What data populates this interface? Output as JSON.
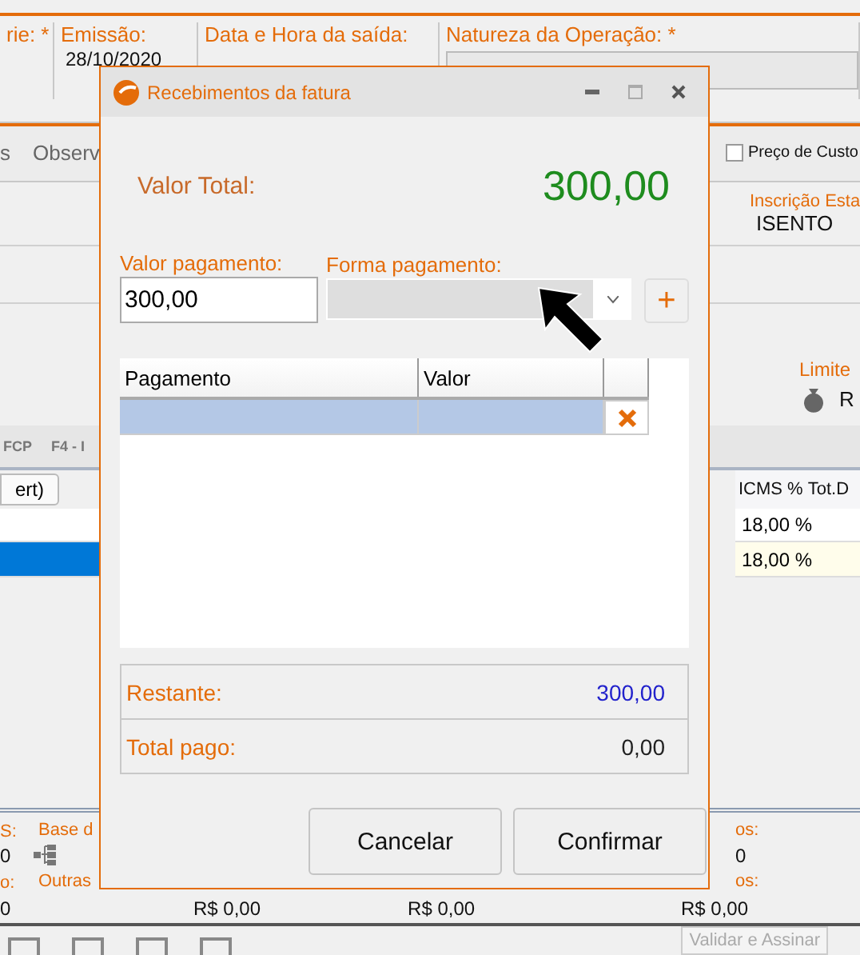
{
  "header": {
    "fields": [
      {
        "label": "rie: *"
      },
      {
        "label": "Emissão:",
        "value": "28/10/2020"
      },
      {
        "label": "Data e Hora da saída:"
      },
      {
        "label": "Natureza da Operação: *"
      }
    ]
  },
  "tabs": [
    {
      "label": "s"
    },
    {
      "label": "Observ"
    }
  ],
  "price_checkbox": {
    "label": "Preço de Custo",
    "checked": false
  },
  "registration": {
    "label": "Inscrição Esta",
    "value": "ISENTO"
  },
  "limit": {
    "label": "Limite",
    "value": "R"
  },
  "strip": [
    "FCP",
    "F4 - I"
  ],
  "left_button": "ert)",
  "grid": {
    "columns": [
      "ICMS %",
      "Tot.D"
    ],
    "rows": [
      {
        "icms": "18,00 %",
        "selected": false
      },
      {
        "icms": "18,00 %",
        "selected": true
      }
    ]
  },
  "totals": {
    "left": [
      {
        "label": "S:",
        "value": "0"
      },
      {
        "label": "o:",
        "value": "0"
      }
    ],
    "middle": [
      "Base d",
      "Outras"
    ],
    "amounts": [
      "R$ 0,00",
      "R$ 0,00"
    ],
    "right": [
      {
        "label": "os:",
        "value": "0"
      },
      {
        "label": "os:",
        "value": "R$ 0,00"
      }
    ]
  },
  "toolbar": {
    "button": "Validar e Assinar"
  },
  "dialog": {
    "title": "Recebimentos da fatura",
    "total_label": "Valor Total:",
    "total_value": "300,00",
    "payment_value": {
      "label": "Valor pagamento:",
      "value": "300,00"
    },
    "payment_method": {
      "label": "Forma pagamento:"
    },
    "add_button": "+",
    "table": {
      "columns": [
        "Pagamento",
        "Valor"
      ],
      "rows": [
        {
          "selected": true
        }
      ]
    },
    "remaining": {
      "label": "Restante:",
      "value": "300,00"
    },
    "paid": {
      "label": "Total pago:",
      "value": "0,00"
    },
    "buttons": [
      "Cancelar",
      "Confirmar"
    ]
  }
}
